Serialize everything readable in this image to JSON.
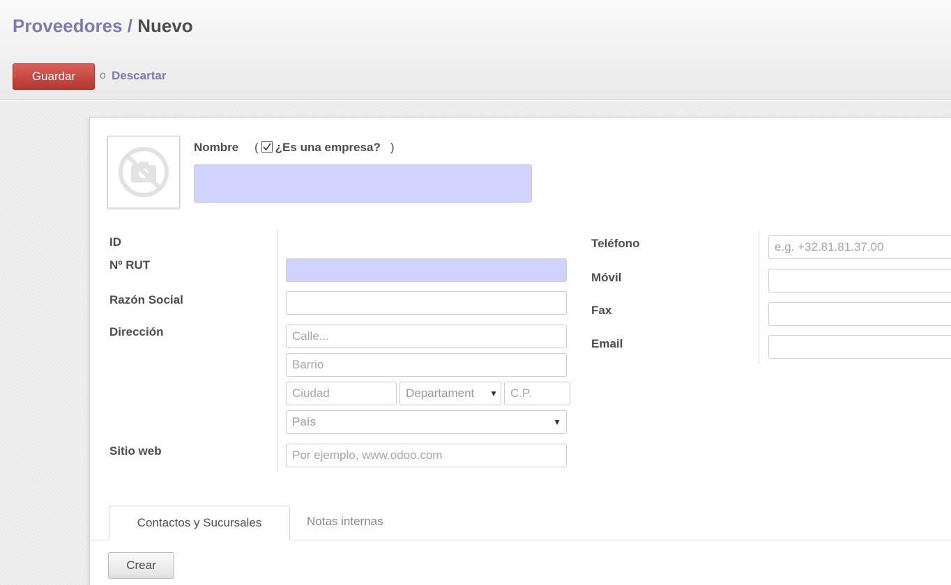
{
  "breadcrumb": {
    "parent": "Proveedores",
    "separator": " / ",
    "current": "Nuevo"
  },
  "actions": {
    "save_label": "Guardar",
    "or_text": "o",
    "discard_label": "Descartar"
  },
  "avatar": {
    "icon": "no-photo-icon"
  },
  "name_section": {
    "name_label": "Nombre",
    "company_checkbox_label": "¿Es una empresa?",
    "company_checked": true,
    "name_value": ""
  },
  "left_fields": {
    "id_label": "ID",
    "rut_label": "Nº RUT",
    "razon_social_label": "Razón Social",
    "direccion_label": "Dirección",
    "sitio_web_label": "Sitio web",
    "street_placeholder": "Calle...",
    "barrio_placeholder": "Barrio",
    "ciudad_placeholder": "Ciudad",
    "departamento_placeholder": "Departament",
    "cp_placeholder": "C.P.",
    "pais_placeholder": "País",
    "website_placeholder": "Por ejemplo, www.odoo.com"
  },
  "right_fields": {
    "telefono_label": "Teléfono",
    "movil_label": "Móvil",
    "fax_label": "Fax",
    "email_label": "Email",
    "telefono_placeholder": "e.g. +32.81.81.37.00"
  },
  "tabs": {
    "active": "Contactos y Sucursales",
    "inactive": "Notas internas"
  },
  "create_label": "Crear",
  "colors": {
    "accent": "#7c7bad",
    "save_button": "#c9423c",
    "required_field": "#d2d2ff"
  }
}
